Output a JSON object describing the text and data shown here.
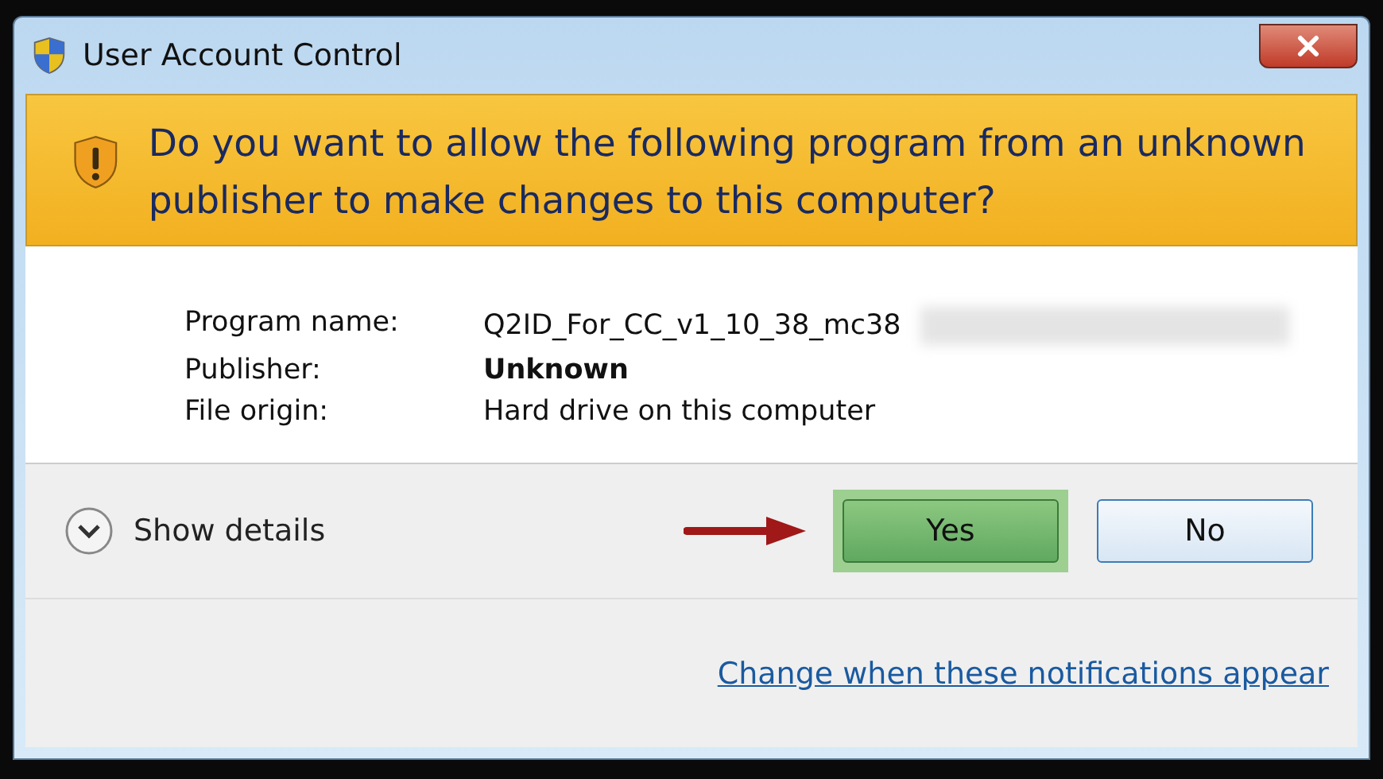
{
  "window": {
    "title": "User Account Control"
  },
  "header": {
    "message": "Do you want to allow the following program from an unknown publisher to make changes to this computer?"
  },
  "details": [
    {
      "label": "Program name:",
      "value": "Q2ID_For_CC_v1_10_38_mc38",
      "bold": false,
      "redacted": true
    },
    {
      "label": "Publisher:",
      "value": "Unknown",
      "bold": true,
      "redacted": false
    },
    {
      "label": "File origin:",
      "value": "Hard drive on this computer",
      "bold": false,
      "redacted": false
    }
  ],
  "show_details": {
    "label": "Show details",
    "expanded": false
  },
  "buttons": [
    {
      "label": "Yes",
      "highlighted": true
    },
    {
      "label": "No",
      "highlighted": false
    }
  ],
  "link": "Change when these notifications appear"
}
